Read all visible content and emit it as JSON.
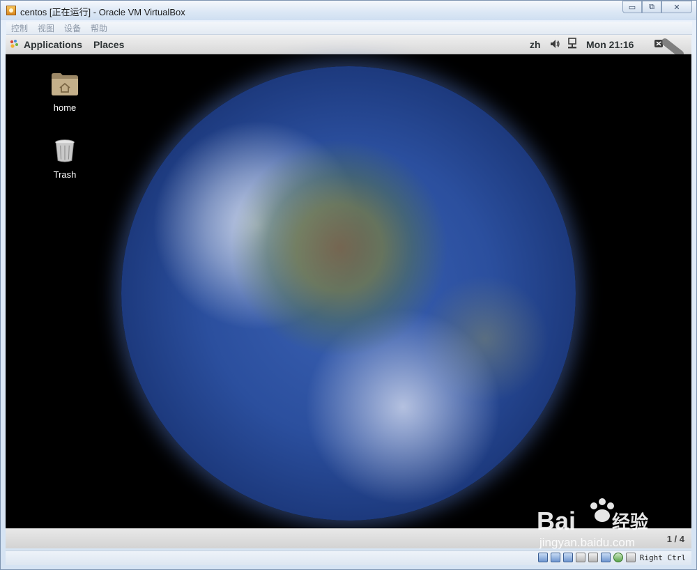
{
  "window": {
    "title": "centos [正在运行] - Oracle VM VirtualBox",
    "minimize_glyph": "▭",
    "restore_glyph": "⧉",
    "close_glyph": "✕"
  },
  "menubar": {
    "items": [
      "控制",
      "视图",
      "设备",
      "帮助"
    ]
  },
  "guest": {
    "topbar": {
      "applications_label": "Applications",
      "places_label": "Places",
      "language": "zh",
      "clock": "Mon 21:16"
    },
    "desktop": {
      "icons": [
        {
          "label": "home",
          "icon": "home-folder-icon"
        },
        {
          "label": "Trash",
          "icon": "trash-icon"
        }
      ],
      "wallpaper": "earth"
    },
    "bottombar": {
      "workspace_indicator": "1 / 4"
    }
  },
  "statusbar": {
    "host_key": "Right Ctrl",
    "icons": [
      "hard-disk-icon",
      "optical-drive-icon",
      "network-icon",
      "usb-icon",
      "shared-folders-icon",
      "display-icon",
      "mouse-integration-icon",
      "keyboard-capture-icon"
    ]
  },
  "watermark": {
    "brand": "Bai",
    "brand_cn": "经验",
    "url": "jingyan.baidu.com"
  },
  "colors": {
    "titlebar": "#dbe7f5",
    "gnome_panel": "#e0e0e0",
    "desktop_bg": "#000000",
    "baidu_blue": "#2b5fd9"
  }
}
